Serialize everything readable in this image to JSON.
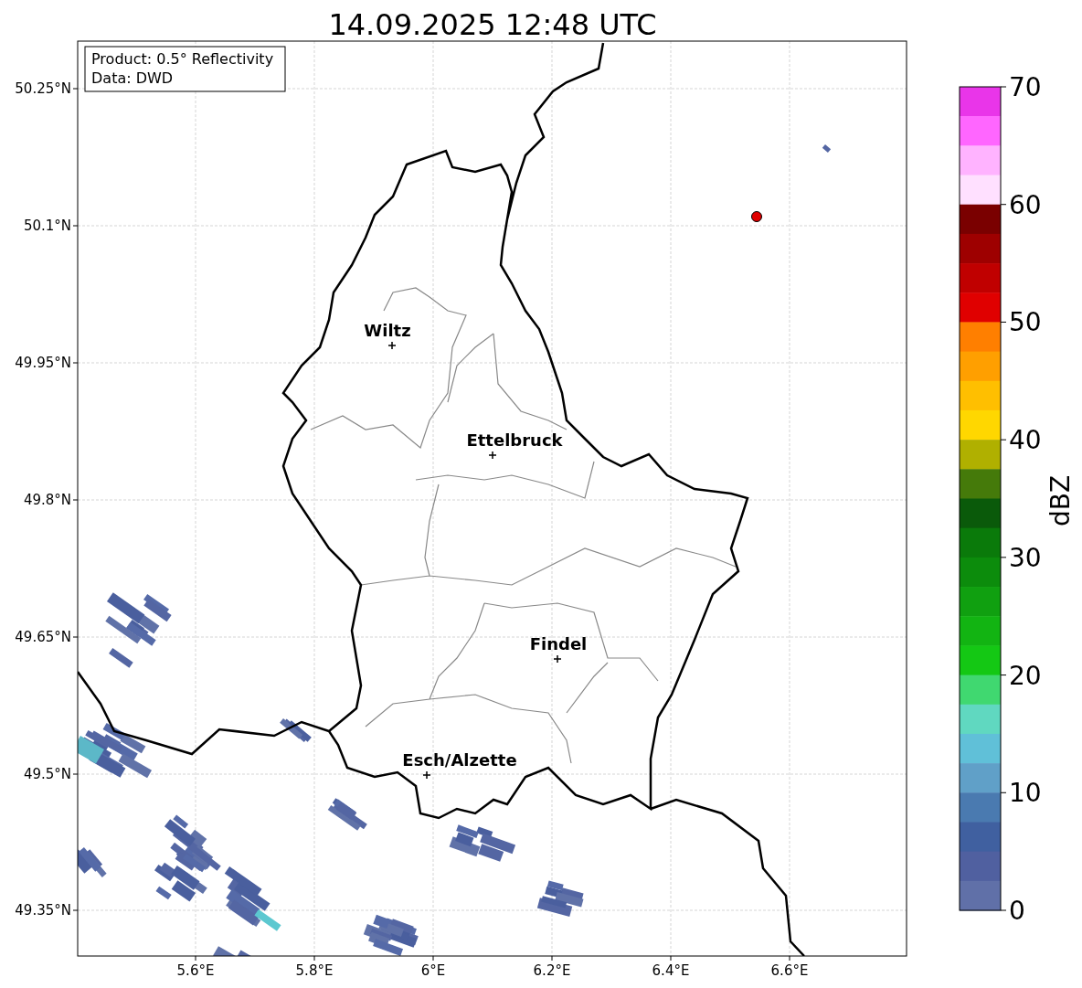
{
  "title": "14.09.2025 12:48 UTC",
  "info_box": [
    "Product: 0.5° Reflectivity",
    "Data: DWD"
  ],
  "map": {
    "cities": [
      {
        "name": "Wiltz"
      },
      {
        "name": "Ettelbruck"
      },
      {
        "name": "Findel"
      },
      {
        "name": "Esch/Alzette"
      }
    ],
    "x_ticks": [
      "5.6°E",
      "5.8°E",
      "6°E",
      "6.2°E",
      "6.4°E",
      "6.6°E"
    ],
    "y_ticks": [
      "50.25°N",
      "50.1°N",
      "49.95°N",
      "49.8°N",
      "49.65°N",
      "49.5°N",
      "49.35°N"
    ]
  },
  "colorbar": {
    "label": "dBZ",
    "ticks": [
      "70",
      "60",
      "50",
      "40",
      "30",
      "20",
      "10",
      "0"
    ],
    "segments": [
      {
        "color": "#e935e9"
      },
      {
        "color": "#ff66ff"
      },
      {
        "color": "#ffb3ff"
      },
      {
        "color": "#ffe0ff"
      },
      {
        "color": "#7a0000"
      },
      {
        "color": "#9e0000"
      },
      {
        "color": "#c00000"
      },
      {
        "color": "#e00000"
      },
      {
        "color": "#ff7f00"
      },
      {
        "color": "#ff9f00"
      },
      {
        "color": "#ffbf00"
      },
      {
        "color": "#ffd700"
      },
      {
        "color": "#b0b000"
      },
      {
        "color": "#457a0a"
      },
      {
        "color": "#0a5a0a"
      },
      {
        "color": "#0a7a0a"
      },
      {
        "color": "#0c8c0c"
      },
      {
        "color": "#10a010"
      },
      {
        "color": "#12b412"
      },
      {
        "color": "#14c814"
      },
      {
        "color": "#40d870"
      },
      {
        "color": "#60d8c0"
      },
      {
        "color": "#60c0d8"
      },
      {
        "color": "#60a0c8"
      },
      {
        "color": "#4a7ab0"
      },
      {
        "color": "#4060a0"
      },
      {
        "color": "#5060a0"
      },
      {
        "color": "#6070a8"
      }
    ]
  }
}
